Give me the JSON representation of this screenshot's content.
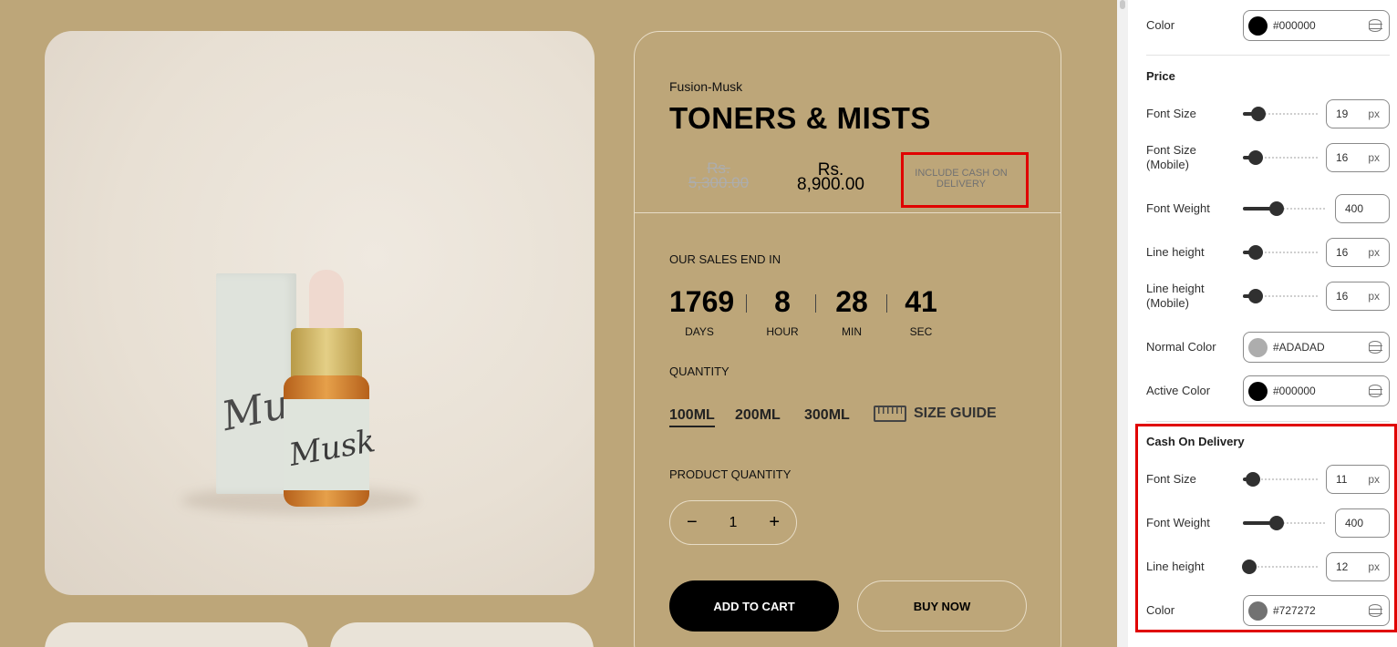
{
  "product": {
    "vendor": "Fusion-Musk",
    "title": "TONERS & MISTS",
    "price_old": "Rs. 5,300.00",
    "price_new": "Rs. 8,900.00",
    "cash_on_delivery": "INCLUDE CASH ON DELIVERY",
    "sales_label": "OUR SALES END IN",
    "countdown": [
      {
        "value": "1769",
        "label": "DAYS"
      },
      {
        "value": "8",
        "label": "HOUR"
      },
      {
        "value": "28",
        "label": "MIN"
      },
      {
        "value": "41",
        "label": "SEC"
      }
    ],
    "quantity_label": "QUANTITY",
    "variants": [
      "100ML",
      "200ML",
      "300ML"
    ],
    "size_guide": "SIZE GUIDE",
    "product_quantity_label": "PRODUCT QUANTITY",
    "stepper": {
      "minus": "−",
      "value": "1",
      "plus": "+"
    },
    "add_to_cart": "ADD TO CART",
    "buy_now": "BUY NOW",
    "image_texts": {
      "box": "Musk",
      "bottle": "Musk"
    }
  },
  "panel": {
    "top_color": {
      "label": "Color",
      "hex": "#000000",
      "swatch": "#000000"
    },
    "price": {
      "title": "Price",
      "font_size": {
        "label": "Font Size",
        "value": "19",
        "unit": "px",
        "level": 0.2
      },
      "font_size_mobile": {
        "label1": "Font Size",
        "label2": "(Mobile)",
        "value": "16",
        "unit": "px",
        "level": 0.17
      },
      "font_weight": {
        "label": "Font Weight",
        "value": "400",
        "level": 0.4
      },
      "line_height": {
        "label": "Line height",
        "value": "16",
        "unit": "px",
        "level": 0.17
      },
      "line_height_mobile": {
        "label1": "Line height",
        "label2": "(Mobile)",
        "value": "16",
        "unit": "px",
        "level": 0.17
      },
      "normal_color": {
        "label": "Normal Color",
        "hex": "#ADADAD",
        "swatch": "#adadad"
      },
      "active_color": {
        "label": "Active Color",
        "hex": "#000000",
        "swatch": "#000000"
      }
    },
    "cod": {
      "title": "Cash On Delivery",
      "font_size": {
        "label": "Font Size",
        "value": "11",
        "unit": "px",
        "level": 0.13
      },
      "font_weight": {
        "label": "Font Weight",
        "value": "400",
        "level": 0.4
      },
      "line_height": {
        "label": "Line height",
        "value": "12",
        "unit": "px",
        "level": 0.08
      },
      "color": {
        "label": "Color",
        "hex": "#727272",
        "swatch": "#727272"
      }
    }
  },
  "colors": {
    "canvas_bg": "#bda679",
    "highlight": "#e00000"
  }
}
